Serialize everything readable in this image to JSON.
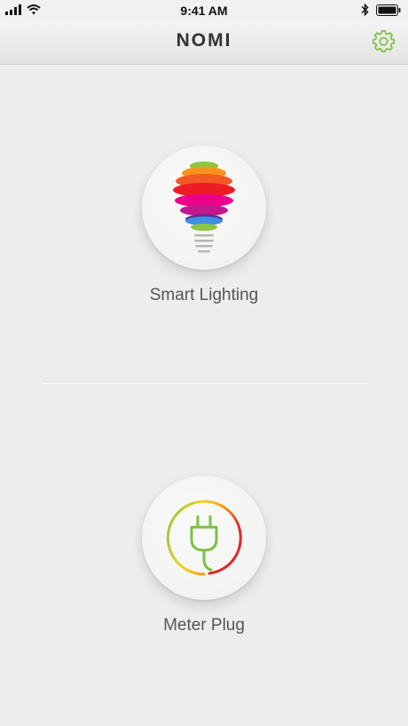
{
  "status_bar": {
    "time": "9:41 AM",
    "icons": [
      "signal-bars-icon",
      "wifi-icon",
      "bluetooth-icon",
      "battery-icon"
    ]
  },
  "nav": {
    "title": "NOMI",
    "settings_icon": "gear-icon",
    "accent_color": "#7cc242"
  },
  "tiles": [
    {
      "label": "Smart Lighting",
      "icon": "rainbow-bulb-icon"
    },
    {
      "label": "Meter Plug",
      "icon": "plug-gauge-icon"
    }
  ],
  "colors": {
    "background": "#ededed",
    "label": "#555555",
    "bulb_layers": [
      "#8cc63f",
      "#f7941d",
      "#f15a24",
      "#ed1c24",
      "#ec008c",
      "#c2188f",
      "#2e3192",
      "#3f8ee8",
      "#8cc63f"
    ]
  }
}
